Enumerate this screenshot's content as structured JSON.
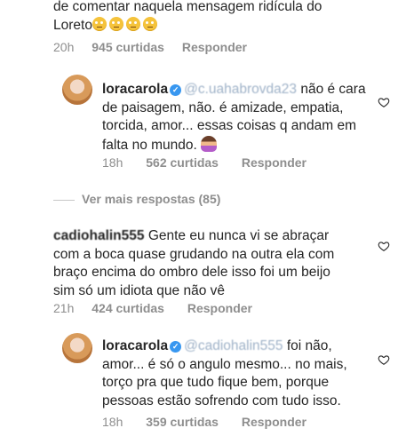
{
  "comment_top": {
    "line1": "de comentar naquela mensagem ridícula do",
    "line2_prefix": "Loreto",
    "emoji_count": 4,
    "time": "20h",
    "likes": "945 curtidas",
    "reply": "Responder"
  },
  "reply1": {
    "username": "loracarola",
    "mention": "@c.uahabrovda23",
    "text_l1": "não é cara",
    "text_l2": "de paisagem, não. é amizade, empatia,",
    "text_l3": "torcida, amor... essas coisas q andam em",
    "text_l4": "falta no mundo.",
    "time": "18h",
    "likes": "562 curtidas",
    "reply": "Responder"
  },
  "view_more": {
    "label": "Ver mais respostas (85)"
  },
  "comment2": {
    "username_blurred": "cadiohalin555",
    "text_l1": "Gente eu nunca vi se abraçar",
    "text_l2": "com a boca quase grudando na outra ela com",
    "text_l3": "braço encima do ombro dele isso foi um beijo",
    "text_l4": "sim só um idiota que não vê",
    "time": "21h",
    "likes": "424 curtidas",
    "reply": "Responder"
  },
  "reply2": {
    "username": "loracarola",
    "mention": "@cadiohalin555",
    "text_l1": "foi não,",
    "text_l2": "amor... é só o angulo mesmo... no mais,",
    "text_l3": "torço pra que tudo fique bem, porque",
    "text_l4": "pessoas estão sofrendo com tudo isso.",
    "time": "18h",
    "likes": "359 curtidas",
    "reply": "Responder"
  },
  "icons": {
    "heart": "heart-outline-icon",
    "verified": "verified-badge-icon"
  },
  "colors": {
    "text": "#262626",
    "meta": "#8e8e8e",
    "verified": "#3897f0",
    "heart": "#262626"
  }
}
